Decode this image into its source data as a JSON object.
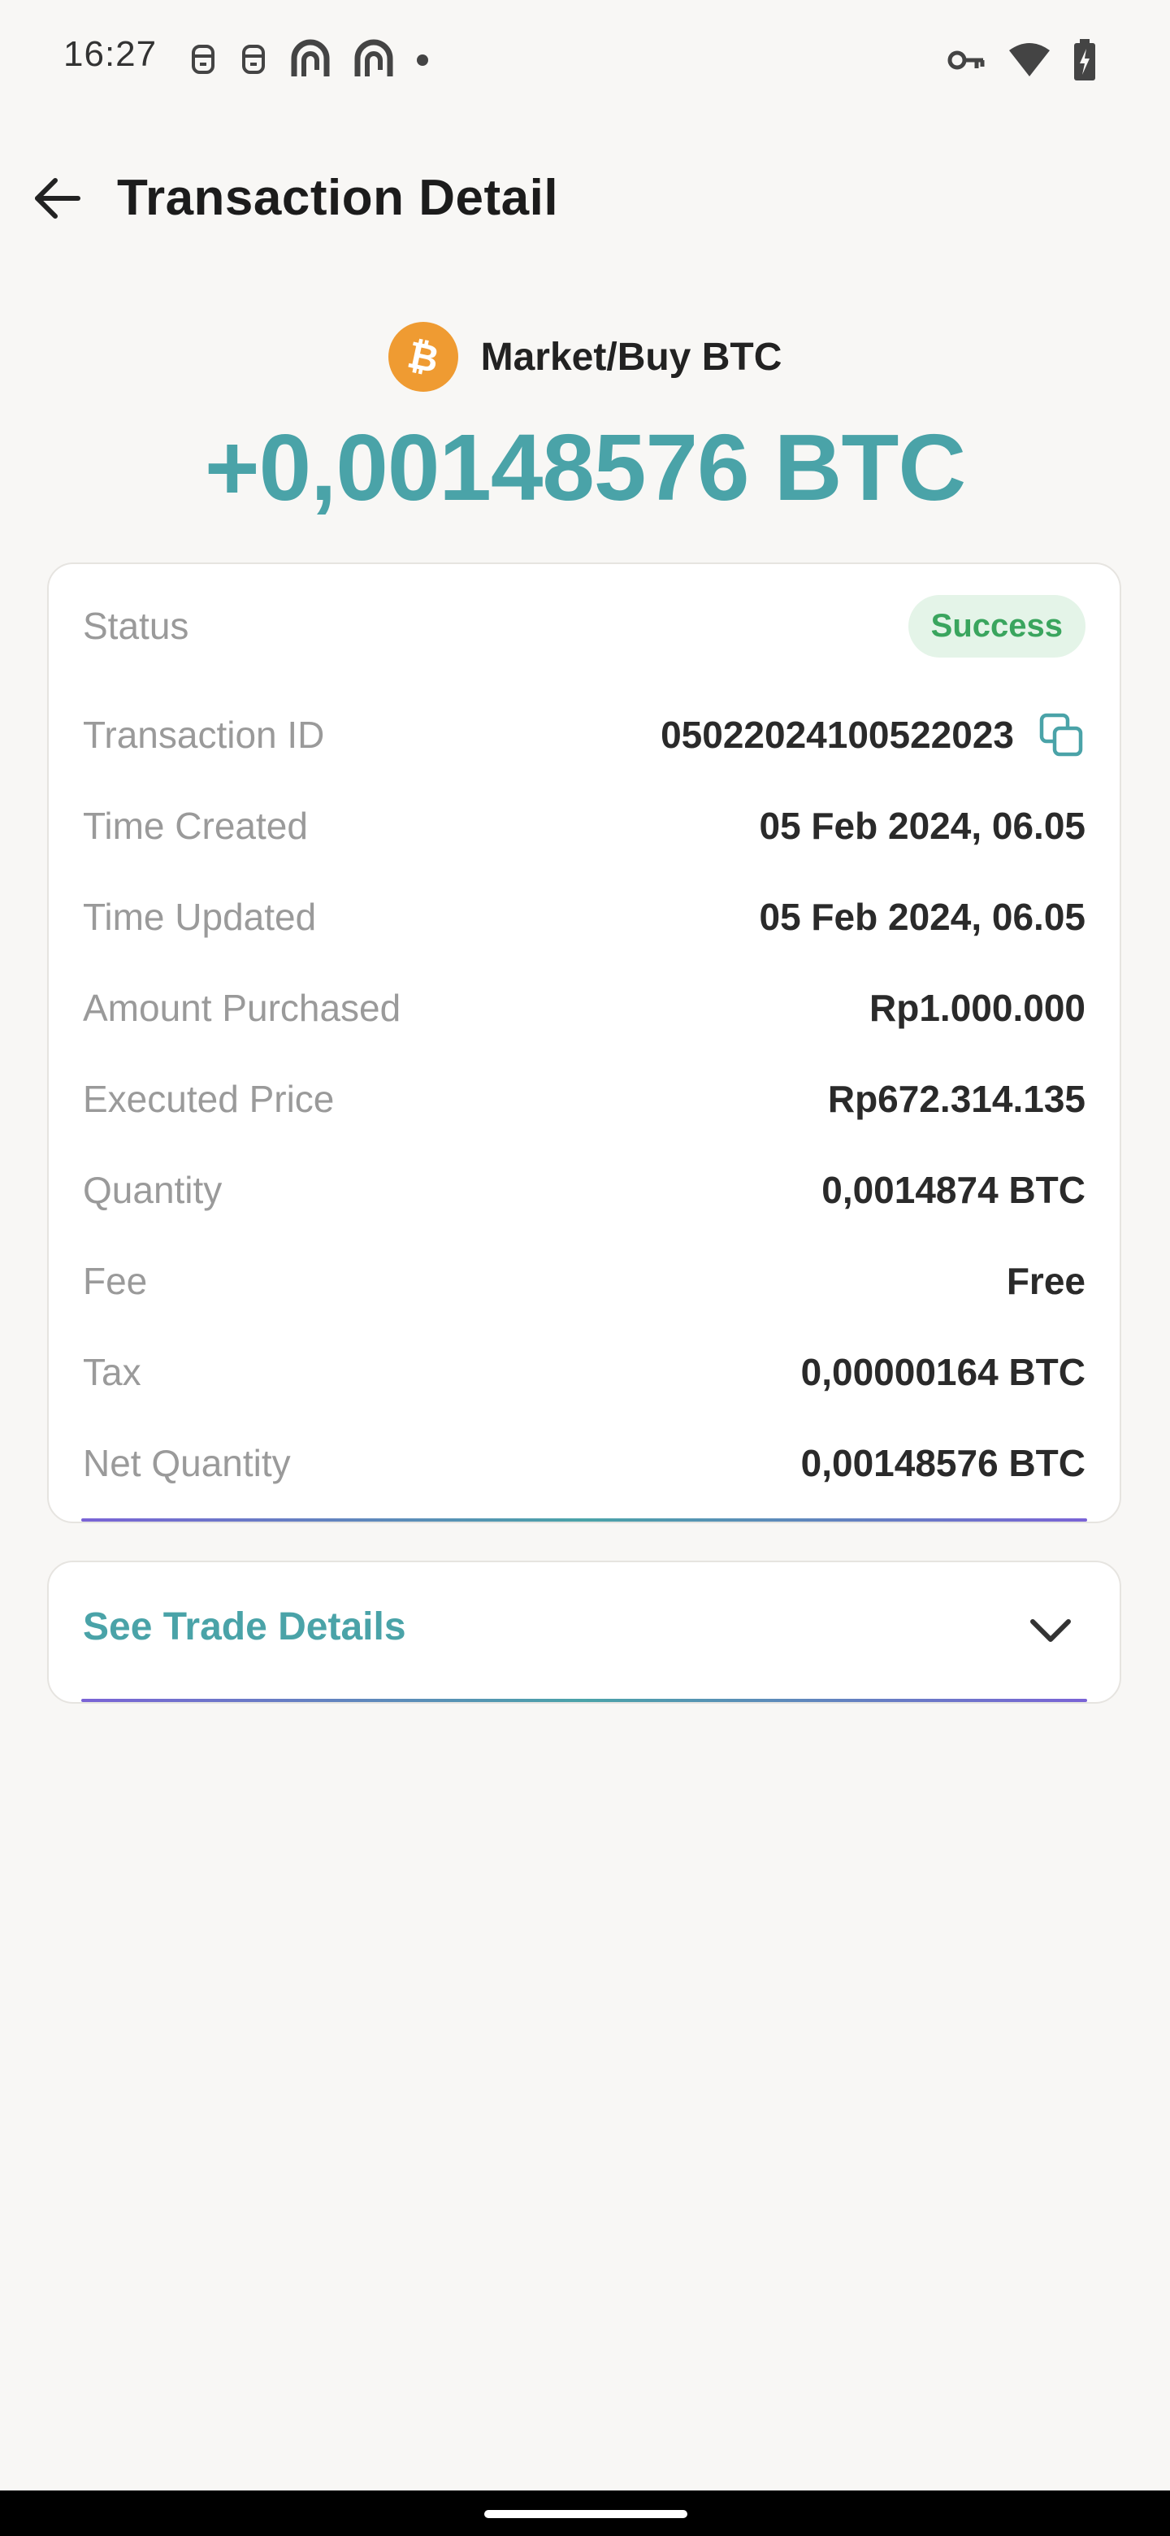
{
  "status_bar": {
    "time": "16:27",
    "left_icons": [
      "notification-icon",
      "notification-icon",
      "app-icon",
      "app-icon",
      "dot-icon"
    ],
    "right_icons": [
      "vpn-key-icon",
      "wifi-icon",
      "battery-icon"
    ]
  },
  "header": {
    "title": "Transaction Detail",
    "back_icon": "arrow-left-icon"
  },
  "hero": {
    "coin_icon": "bitcoin-icon",
    "label": "Market/Buy BTC",
    "amount": "+0,00148576 BTC"
  },
  "details": {
    "status_label": "Status",
    "status_value": "Success",
    "txid_label": "Transaction ID",
    "txid_value": "05022024100522023",
    "created_label": "Time Created",
    "created_value": "05 Feb 2024, 06.05",
    "updated_label": "Time Updated",
    "updated_value": "05 Feb 2024, 06.05",
    "amount_label": "Amount Purchased",
    "amount_value": "Rp1.000.000",
    "price_label": "Executed Price",
    "price_value": "Rp672.314.135",
    "quantity_label": "Quantity",
    "quantity_value": "0,0014874 BTC",
    "fee_label": "Fee",
    "fee_value": "Free",
    "tax_label": "Tax",
    "tax_value": "0,00000164 BTC",
    "net_label": "Net Quantity",
    "net_value": "0,00148576 BTC"
  },
  "trade_details": {
    "label": "See Trade Details",
    "icon": "chevron-down-icon"
  },
  "colors": {
    "accent": "#4aa3a8",
    "success_text": "#3aa55e",
    "success_bg": "#e4f4e8",
    "bitcoin": "#ef9b32",
    "background": "#f8f7f5"
  }
}
